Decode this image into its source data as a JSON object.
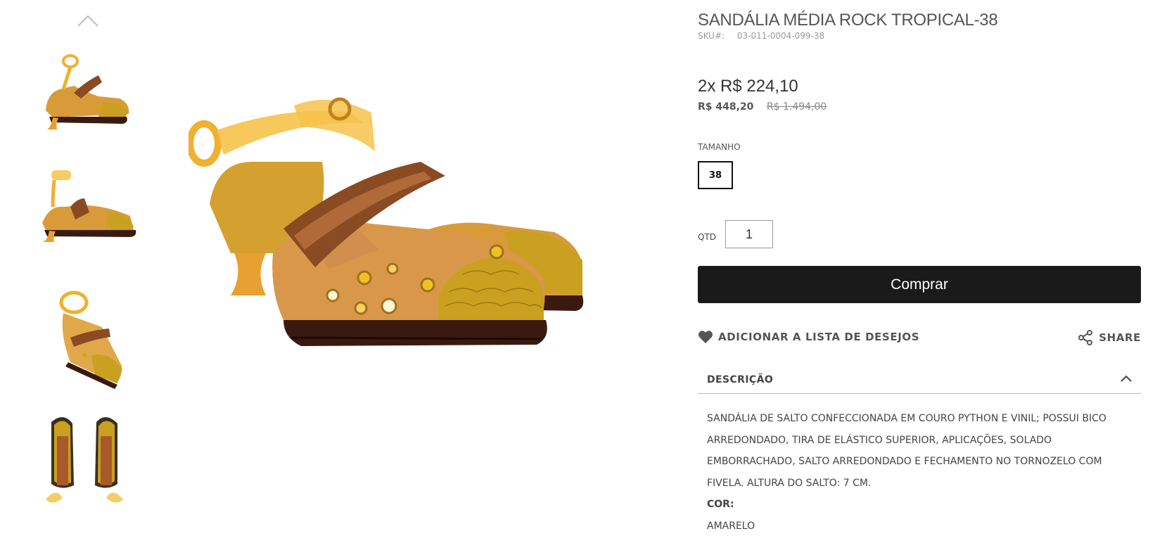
{
  "gallery": {
    "thumbnails": [
      {
        "name": "thumb-side-front"
      },
      {
        "name": "thumb-side"
      },
      {
        "name": "thumb-angle"
      },
      {
        "name": "thumb-top"
      }
    ],
    "scroll_up_icon": "chevron-up-icon"
  },
  "product": {
    "title": "SANDÁLIA MÉDIA ROCK TROPICAL-38",
    "sku_label": "SKU#:",
    "sku_value": "03-011-0004-099-38",
    "installments": "2x R$ 224,10",
    "price": "R$ 448,20",
    "old_price": "R$ 1.494,00"
  },
  "size": {
    "label": "TAMANHO",
    "selected": "38"
  },
  "quantity": {
    "label": "QTD",
    "value": "1"
  },
  "actions": {
    "buy_label": "Comprar",
    "wishlist_label": "ADICIONAR A LISTA DE DESEJOS",
    "wishlist_icon": "heart-icon",
    "share_label": "SHARE",
    "share_icon": "share-icon"
  },
  "description": {
    "title": "DESCRIÇÃO",
    "text": "SANDÁLIA DE SALTO CONFECCIONADA EM COURO PYTHON E VINIL; POSSUI BICO ARREDONDADO, TIRA DE ELÁSTICO SUPERIOR, APLICAÇÕES, SOLADO EMBORRACHADO, SALTO ARREDONDADO E FECHAMENTO NO TORNOZELO COM FIVELA. ALTURA DO SALTO: 7 CM.",
    "color_label": "COR:",
    "color_value": "AMARELO"
  },
  "colors": {
    "button_bg": "#1a1a1a",
    "shoe_yellow": "#e8b830",
    "shoe_brown": "#8a4a22",
    "sole": "#3a1a10"
  }
}
